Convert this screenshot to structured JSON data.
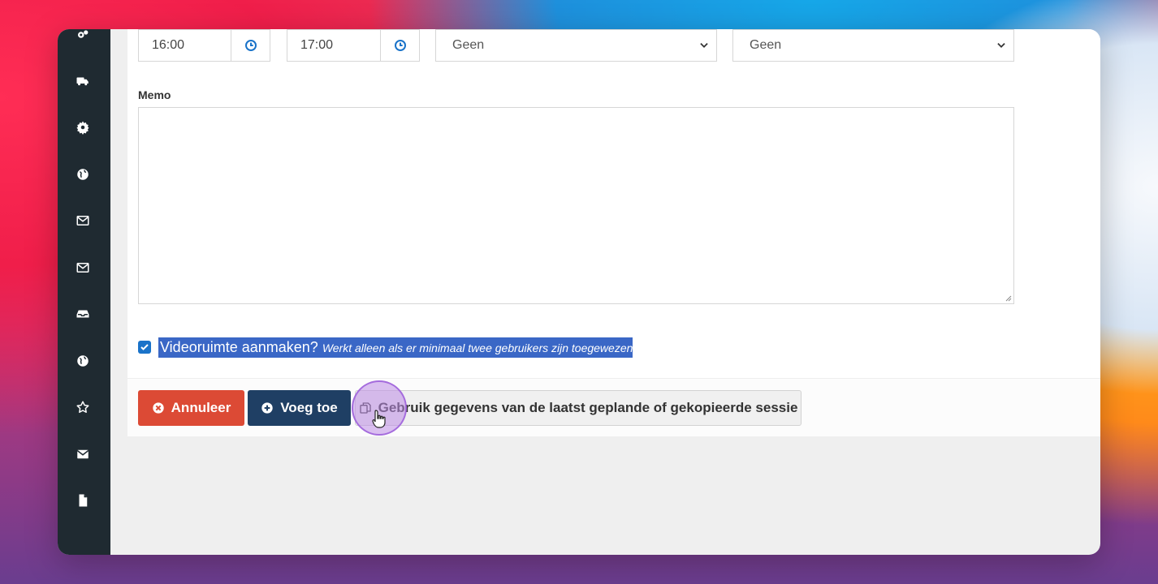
{
  "sidebar": {
    "items": [
      {
        "icon": "gears-icon"
      },
      {
        "icon": "truck-icon"
      },
      {
        "icon": "gear-icon"
      },
      {
        "icon": "globe-icon"
      },
      {
        "icon": "envelope-outline-icon"
      },
      {
        "icon": "envelope-outline-icon"
      },
      {
        "icon": "inbox-icon"
      },
      {
        "icon": "globe-icon"
      },
      {
        "icon": "star-outline-icon"
      },
      {
        "icon": "envelope-icon"
      },
      {
        "icon": "file-icon"
      }
    ]
  },
  "form": {
    "start_time": "16:00",
    "end_time": "17:00",
    "select_1": "Geen",
    "select_2": "Geen",
    "memo_label": "Memo",
    "memo_value": "",
    "video_checkbox_checked": true,
    "video_label": "Videoruimte aanmaken?",
    "video_hint": "Werkt alleen als er minimaal twee gebruikers zijn toegewezen"
  },
  "actions": {
    "cancel_label": "Annuleer",
    "add_label": "Voeg toe",
    "use_last_label": "Gebruik gegevens van de laatst geplande of gekopieerde sessie"
  },
  "colors": {
    "sidebar_bg": "#1f2a31",
    "cancel_bg": "#dc4a35",
    "add_bg": "#1f3f64",
    "selection": "#3a67c6",
    "clock_icon": "#1a73c9"
  }
}
